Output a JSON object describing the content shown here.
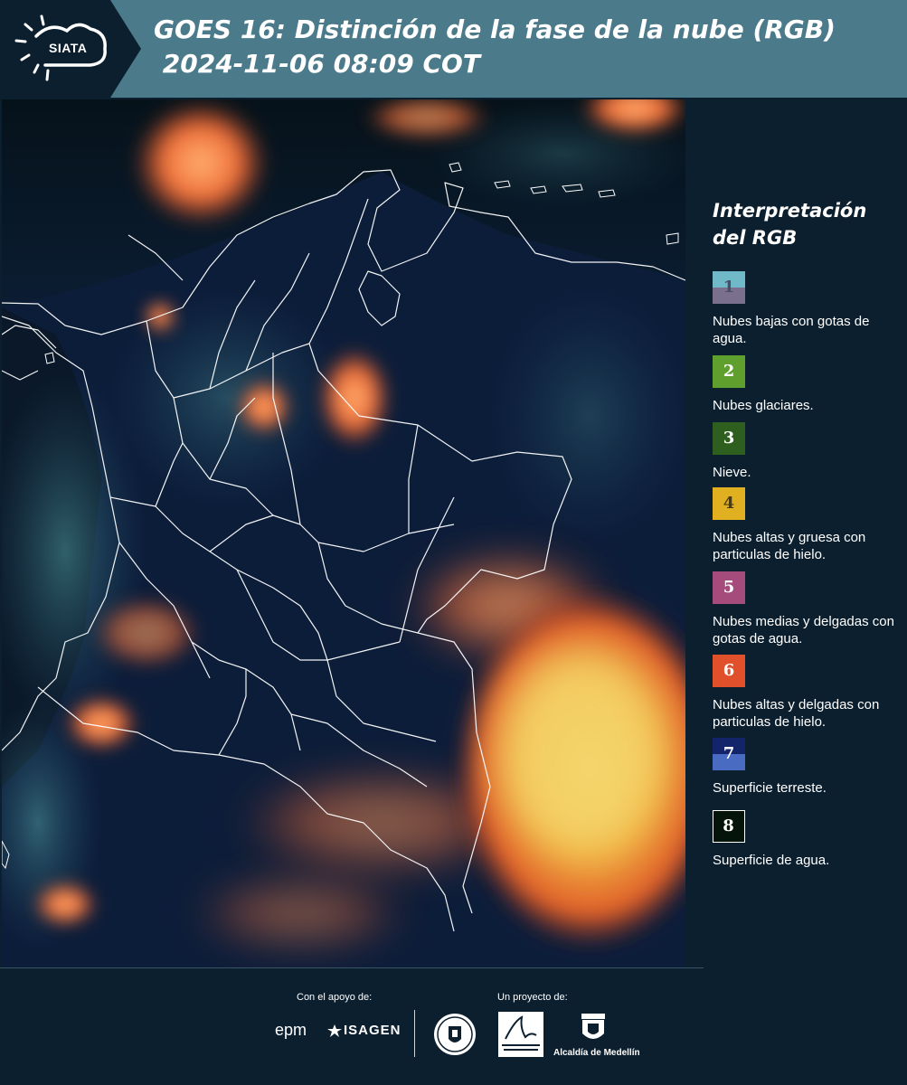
{
  "header": {
    "logo": "SIATA",
    "title_line1": "GOES 16: Distinción de la fase de la nube (RGB)",
    "title_line2": " 2024-11-06 08:09 COT"
  },
  "legend": {
    "title": "Interpretación del RGB",
    "items": [
      {
        "number": "1",
        "label": "Nubes bajas con gotas de agua.",
        "color_top": "#6fb9c8",
        "color_bottom": "#7a6f8d"
      },
      {
        "number": "2",
        "label": "Nubes glaciares.",
        "color": "#5f9f2e"
      },
      {
        "number": "3",
        "label": "Nieve.",
        "color": "#2e5f1f"
      },
      {
        "number": "4",
        "label": "Nubes altas y gruesa con particulas de hielo.",
        "color": "#e0b021"
      },
      {
        "number": "5",
        "label": "Nubes medias y delgadas con gotas de agua.",
        "color": "#a64c7c"
      },
      {
        "number": "6",
        "label": "Nubes altas y delgadas con particulas de hielo.",
        "color": "#e0502a"
      },
      {
        "number": "7",
        "label": "Superficie terreste.",
        "color_top": "#14246b",
        "color_bottom": "#4a6bc2"
      },
      {
        "number": "8",
        "label": "Superficie de agua.",
        "color": "#05140a"
      }
    ]
  },
  "footer": {
    "support_label": "Con el apoyo de:",
    "project_label": "Un proyecto de:",
    "epm": "epm",
    "isagen": "ISAGEN",
    "area_logo": "Área METROPOLITANA Valle de Aburrá",
    "alcaldia": "Alcaldía de Medellín"
  },
  "colors": {
    "header_bg": "#4b7a8a",
    "page_bg": "#0c1f2e",
    "map_bg": "#0a1830"
  }
}
